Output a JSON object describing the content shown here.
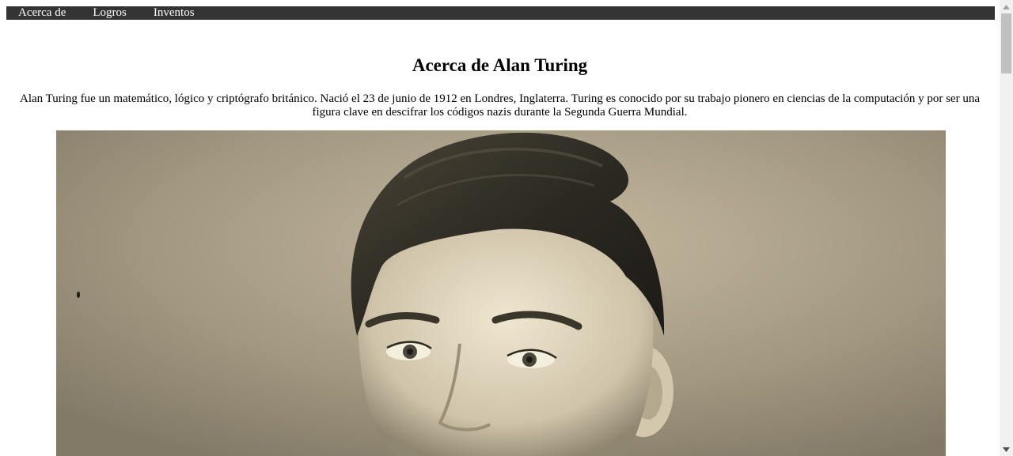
{
  "nav": {
    "items": [
      {
        "label": "Acerca de"
      },
      {
        "label": "Logros"
      },
      {
        "label": "Inventos"
      }
    ]
  },
  "main": {
    "title": "Acerca de Alan Turing",
    "intro": "Alan Turing fue un matemático, lógico y criptógrafo británico. Nació el 23 de junio de 1912 en Londres, Inglaterra. Turing es conocido por su trabajo pionero en ciencias de la computación y por ser una figura clave en descifrar los códigos nazis durante la Segunda Guerra Mundial."
  },
  "colors": {
    "navbar": "#333333",
    "nav_text": "#ffffff",
    "scrollbar_track": "#f1f1f1",
    "scrollbar_thumb": "#c1c1c1"
  }
}
